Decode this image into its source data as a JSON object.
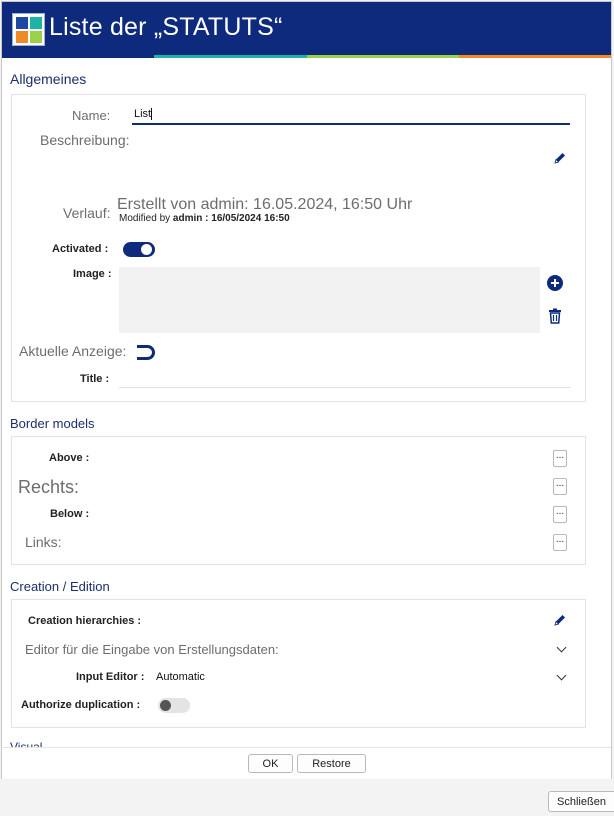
{
  "window": {
    "title": "Liste der „STATUTS“"
  },
  "colors": {
    "brand": "#0d2a7c",
    "stripe_1": "#0d2a7c",
    "stripe_2": "#1fb2a6",
    "stripe_3": "#9bd04a",
    "stripe_4": "#f08a24"
  },
  "general": {
    "section_title": "Allgemeines",
    "name_label": "Name:",
    "name_value": "List",
    "description_label": "Beschreibung:",
    "history_label": "Verlauf:",
    "history_created": "Erstellt von admin: 16.05.2024, 16:50 Uhr",
    "history_modified_prefix": "Modified by ",
    "history_modified_value": "admin : 16/05/2024 16:50",
    "activated_label": "Activated :",
    "activated_on": true,
    "image_label": "Image :",
    "current_display_label": "Aktuelle Anzeige:",
    "title_label": "Title :"
  },
  "border_models": {
    "section_title": "Border models",
    "above_label": "Above :",
    "right_label": "Rechts:",
    "below_label": "Below :",
    "left_label": "Links:",
    "dots": "..."
  },
  "creation": {
    "section_title": "Creation / Edition",
    "hierarchies_label": "Creation hierarchies :",
    "editor_label": "Editor für die Eingabe von Erstellungsdaten:",
    "input_editor_label": "Input Editor :",
    "input_editor_value": "Automatic",
    "authorize_duplication_label": "Authorize duplication :",
    "authorize_duplication_on": false
  },
  "next_section_partial": "Visual",
  "footer": {
    "ok": "OK",
    "restore": "Restore"
  },
  "close_button": "Schließen"
}
